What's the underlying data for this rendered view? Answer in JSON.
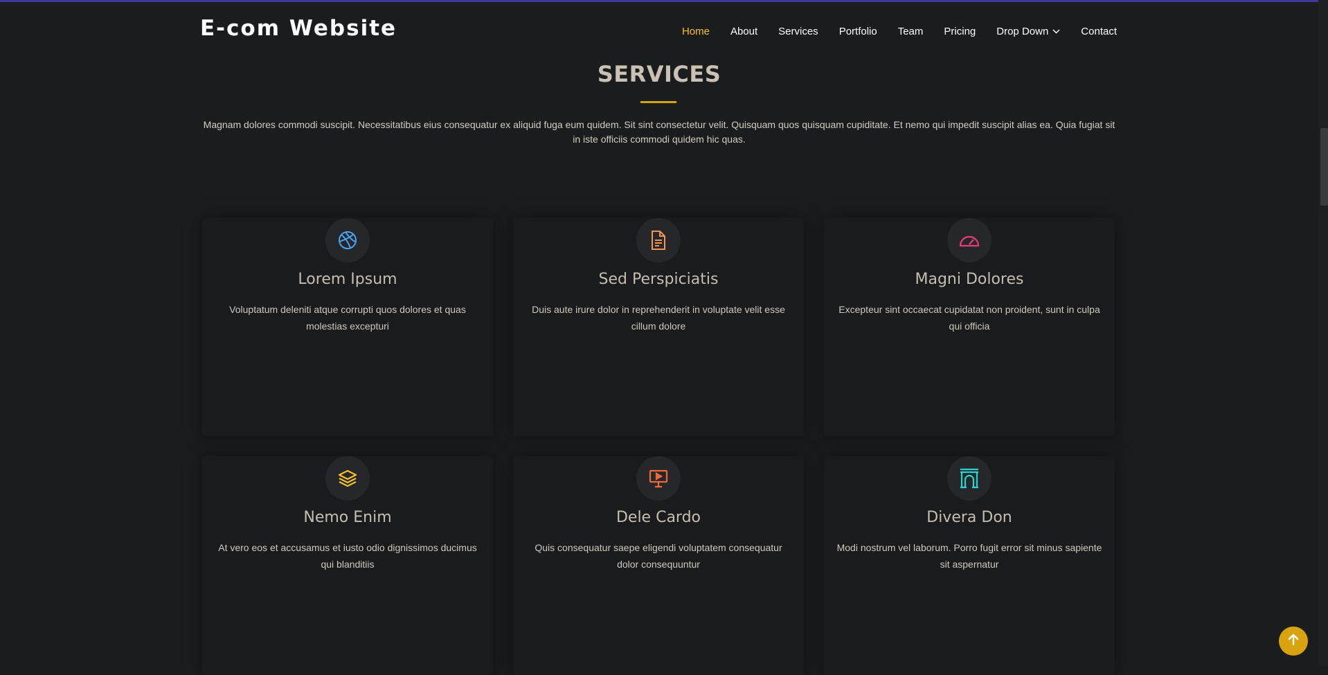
{
  "header": {
    "logo": "E-com Website",
    "nav": [
      {
        "label": "Home",
        "active": true
      },
      {
        "label": "About"
      },
      {
        "label": "Services"
      },
      {
        "label": "Portfolio"
      },
      {
        "label": "Team"
      },
      {
        "label": "Pricing"
      },
      {
        "label": "Drop Down",
        "dropdown": true
      },
      {
        "label": "Contact"
      }
    ]
  },
  "section": {
    "title": "SERVICES",
    "description": "Magnam dolores commodi suscipit. Necessitatibus eius consequatur ex aliquid fuga eum quidem. Sit sint consectetur velit. Quisquam quos quisquam cupiditate. Et nemo qui impedit suscipit alias ea. Quia fugiat sit in iste officiis commodi quidem hic quas."
  },
  "services": [
    {
      "icon": "dribbble-icon",
      "color": "#4aa3f0",
      "title": "Lorem Ipsum",
      "text": "Voluptatum deleniti atque corrupti quos dolores et quas molestias excepturi"
    },
    {
      "icon": "document-icon",
      "color": "#f39652",
      "title": "Sed Perspiciatis",
      "text": "Duis aute irure dolor in reprehenderit in voluptate velit esse cillum dolore"
    },
    {
      "icon": "speedometer-icon",
      "color": "#e93a7d",
      "title": "Magni Dolores",
      "text": "Excepteur sint occaecat cupidatat non proident, sunt in culpa qui officia"
    },
    {
      "icon": "layers-icon",
      "color": "#f5c02a",
      "title": "Nemo Enim",
      "text": "At vero eos et accusamus et iusto odio dignissimos ducimus qui blanditiis"
    },
    {
      "icon": "presentation-icon",
      "color": "#f06a36",
      "title": "Dele Cardo",
      "text": "Quis consequatur saepe eligendi voluptatem consequatur dolor consequuntur"
    },
    {
      "icon": "arch-icon",
      "color": "#25d5d0",
      "title": "Divera Don",
      "text": "Modi nostrum vel laborum. Porro fugit error sit minus sapiente sit aspernatur"
    }
  ],
  "colors": {
    "accent": "#f4c11e",
    "background": "#1b1c1e",
    "back_to_top": "#d9a30f"
  },
  "back_to_top_icon": "arrow-up-icon"
}
